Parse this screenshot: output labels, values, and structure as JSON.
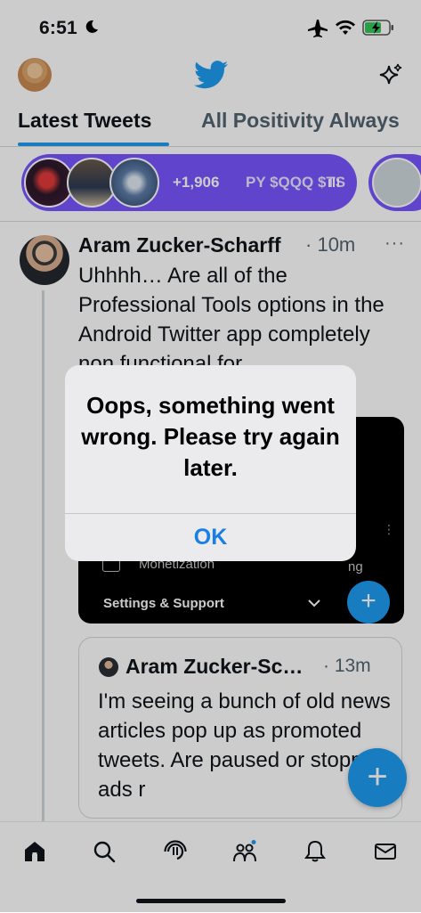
{
  "status_bar": {
    "time": "6:51",
    "icons": [
      "moon-icon",
      "airplane-icon",
      "wifi-icon",
      "battery-charging-icon"
    ]
  },
  "header": {
    "logo": "twitter-bird-icon",
    "right_icon": "sparkle-icon"
  },
  "tabs": [
    {
      "label": "Latest Tweets",
      "active": true
    },
    {
      "label": "All Positivity Always",
      "active": false
    }
  ],
  "spaces": {
    "listener_count": "+1,906",
    "ticker_text": "PY $QQQ $TS"
  },
  "tweet": {
    "author": "Aram Zucker-Scharff",
    "time": "10m",
    "text": "Uhhhh… Are all of the Professional Tools options in the Android Twitter app completely non functional for",
    "media": {
      "menu_item": "Monetization",
      "partial_text": "ng",
      "section": "Settings & Support"
    }
  },
  "quote_tweet": {
    "author": "Aram Zucker-Sc…",
    "time": "13m",
    "text": "I'm seeing a bunch of old news articles pop up as promoted tweets. Are paused or stopped ads r"
  },
  "alert": {
    "message": "Oops, something went wrong. Please try again later.",
    "button": "OK"
  },
  "bottom_nav": [
    "home-icon",
    "search-icon",
    "spaces-icon",
    "communities-icon",
    "notifications-icon",
    "messages-icon"
  ],
  "colors": {
    "accent": "#1d9bf0",
    "spaces": "#7856ff",
    "alert_button": "#1a7fe3"
  }
}
